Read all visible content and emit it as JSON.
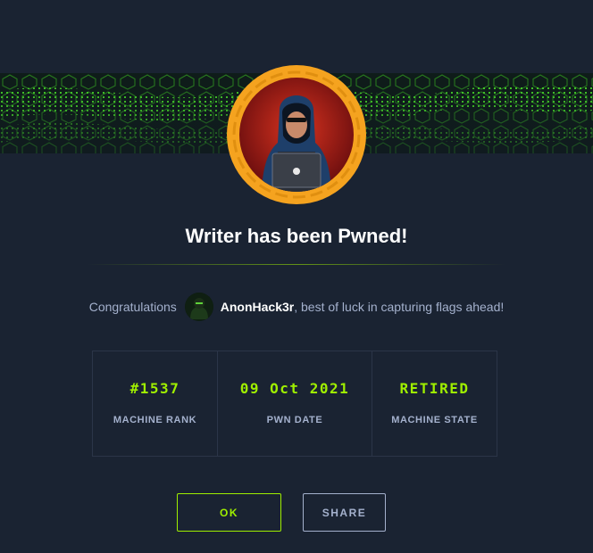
{
  "dialog": {
    "title": "Writer has been Pwned!",
    "congrats_prefix": "Congratulations",
    "username": "AnonHack3r",
    "congrats_suffix": ", best of luck in capturing flags ahead!",
    "avatar_icon": "hooded-hacker-icon",
    "user_avatar_icon": "user-avatar-icon",
    "banner": "green-hex-grid-banner"
  },
  "stats": [
    {
      "value": "#1537",
      "label": "MACHINE RANK"
    },
    {
      "value": "09 Oct 2021",
      "label": "PWN DATE"
    },
    {
      "value": "RETIRED",
      "label": "MACHINE STATE"
    }
  ],
  "buttons": {
    "ok_label": "OK",
    "share_label": "SHARE"
  },
  "colors": {
    "background": "#1a2332",
    "accent_green": "#9fef00",
    "ring_orange": "#f5a31f",
    "muted_text": "#a4b1cd"
  }
}
